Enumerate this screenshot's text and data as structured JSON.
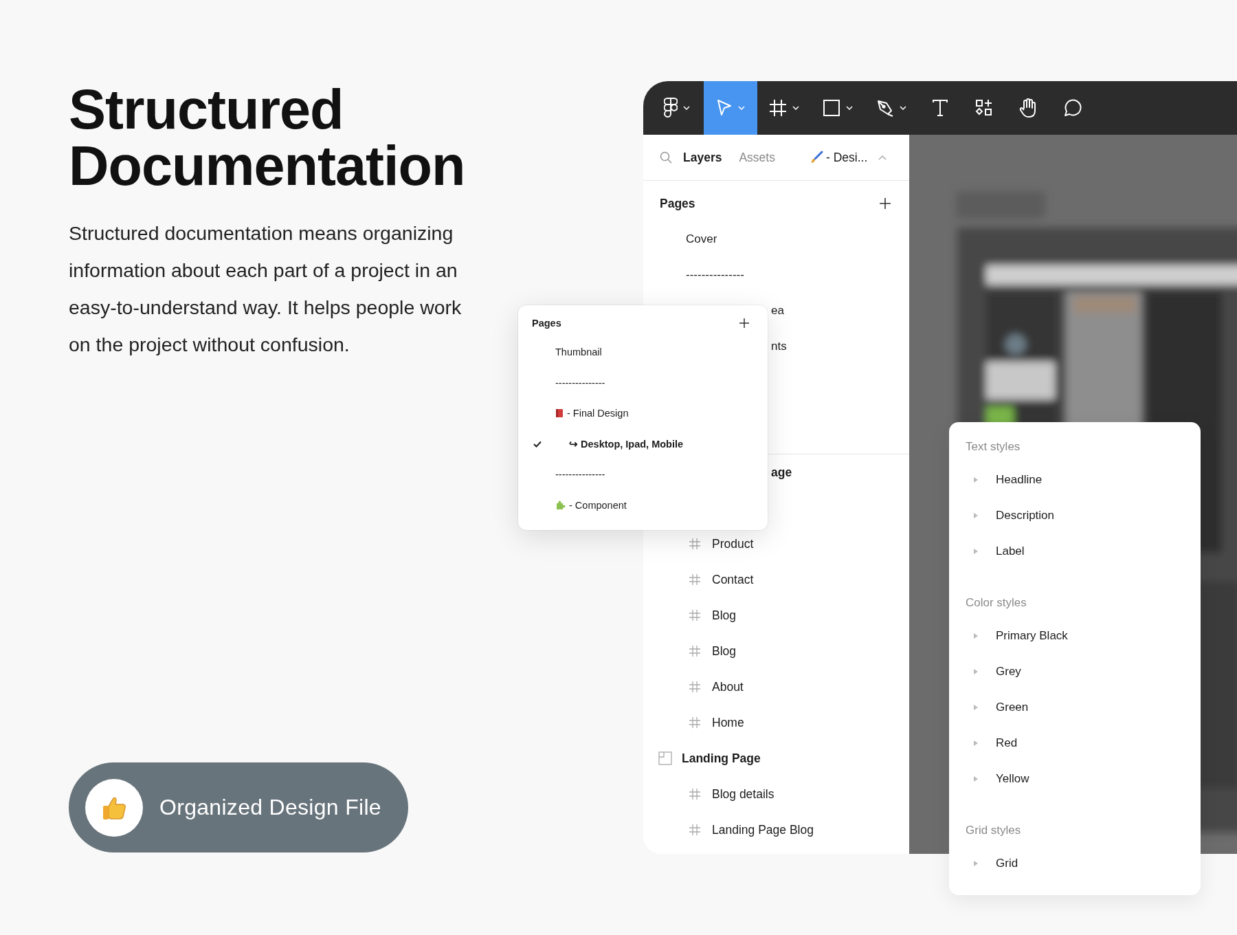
{
  "headline": "Structured Documentation",
  "description": "Structured documentation means organizing information about each part of a project in an easy-to-understand way. It helps people work on the project without confusion.",
  "badge": {
    "label": "Organized Design File"
  },
  "toolbar": {
    "tools": [
      {
        "selected": false,
        "has_menu": true
      },
      {
        "selected": true,
        "has_menu": true
      },
      {
        "selected": false,
        "has_menu": true
      },
      {
        "selected": false,
        "has_menu": true
      },
      {
        "selected": false,
        "has_menu": true
      },
      {
        "selected": false,
        "has_menu": false
      },
      {
        "selected": false,
        "has_menu": false
      },
      {
        "selected": false,
        "has_menu": false
      },
      {
        "selected": false,
        "has_menu": false
      }
    ]
  },
  "layers_panel": {
    "tabs": [
      {
        "label": "Layers",
        "selected": true
      },
      {
        "label": "Assets",
        "selected": false
      }
    ],
    "page_menu": {
      "label": "- Desi..."
    },
    "pages_title": "Pages",
    "pages": [
      {
        "label": "Cover",
        "kind": "page"
      },
      {
        "label": "---------------",
        "kind": "page"
      },
      {
        "label": "ea",
        "kind": "fragment"
      },
      {
        "label": "nts",
        "kind": "fragment"
      }
    ],
    "layers": [
      {
        "label": "age",
        "kind": "fragment"
      },
      {
        "label": "Product",
        "kind": "frame"
      },
      {
        "label": "Contact",
        "kind": "frame"
      },
      {
        "label": "Blog",
        "kind": "frame"
      },
      {
        "label": "Blog",
        "kind": "frame"
      },
      {
        "label": "About",
        "kind": "frame"
      },
      {
        "label": "Home",
        "kind": "frame"
      },
      {
        "label": "Landing Page",
        "kind": "section"
      },
      {
        "label": "Blog details",
        "kind": "frame"
      },
      {
        "label": "Landing Page Blog",
        "kind": "frame"
      }
    ]
  },
  "pages_popup": {
    "title": "Pages",
    "items": [
      {
        "label": "Thumbnail",
        "kind": "page",
        "checked": false
      },
      {
        "label": "---------------",
        "kind": "page",
        "checked": false
      },
      {
        "label": "- Final Design",
        "kind": "page",
        "checked": false
      },
      {
        "label": "↪ Desktop, Ipad, Mobile",
        "kind": "subpage",
        "checked": true
      },
      {
        "label": "---------------",
        "kind": "page",
        "checked": false
      },
      {
        "label": "- Component",
        "kind": "page",
        "checked": false
      }
    ]
  },
  "styles_card": {
    "sections": [
      {
        "title": "Text styles",
        "items": [
          "Headline",
          "Description",
          "Label"
        ]
      },
      {
        "title": "Color styles",
        "items": [
          "Primary Black",
          "Grey",
          "Green",
          "Red",
          "Yellow"
        ]
      },
      {
        "title": "Grid styles",
        "items": [
          "Grid"
        ]
      }
    ]
  }
}
